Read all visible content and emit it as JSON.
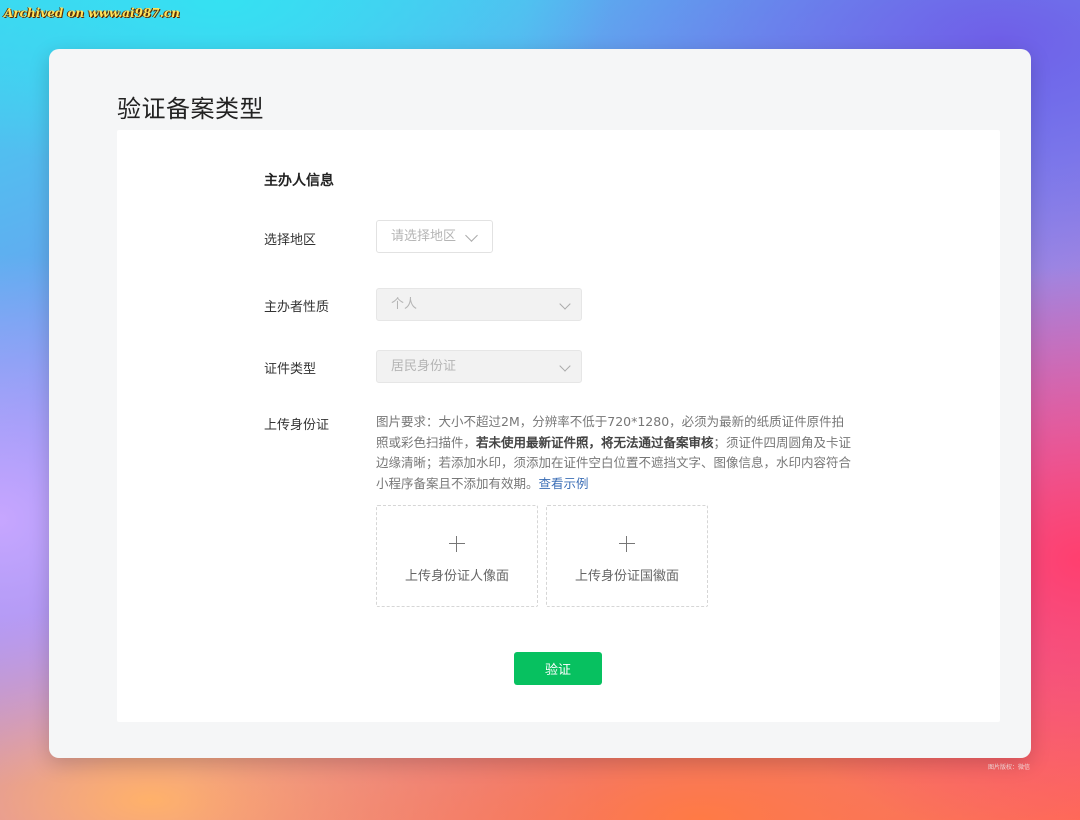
{
  "watermark": "Archived on www.ai987.cn",
  "corner_mark": "图片版权：微信",
  "page_title": "验证备案类型",
  "section_title": "主办人信息",
  "fields": {
    "region": {
      "label": "选择地区",
      "placeholder": "请选择地区"
    },
    "host_type": {
      "label": "主办者性质",
      "value": "个人"
    },
    "id_type": {
      "label": "证件类型",
      "value": "居民身份证"
    },
    "upload_id": {
      "label": "上传身份证"
    }
  },
  "requirements": {
    "part1": "图片要求：大小不超过2M，分辨率不低于720*1280，必须为最新的纸质证件原件拍照或彩色扫描件，",
    "bold": "若未使用最新证件照，将无法通过备案审核",
    "part2": "；须证件四周圆角及卡证边缘清晰；若添加水印，须添加在证件空白位置不遮挡文字、图像信息，水印内容符合小程序备案且不添加有效期。",
    "example_link": "查看示例"
  },
  "uploads": {
    "front": "上传身份证人像面",
    "back": "上传身份证国徽面"
  },
  "verify_button": "验证",
  "colors": {
    "accent": "#07c160",
    "link": "#3d6fb6"
  }
}
